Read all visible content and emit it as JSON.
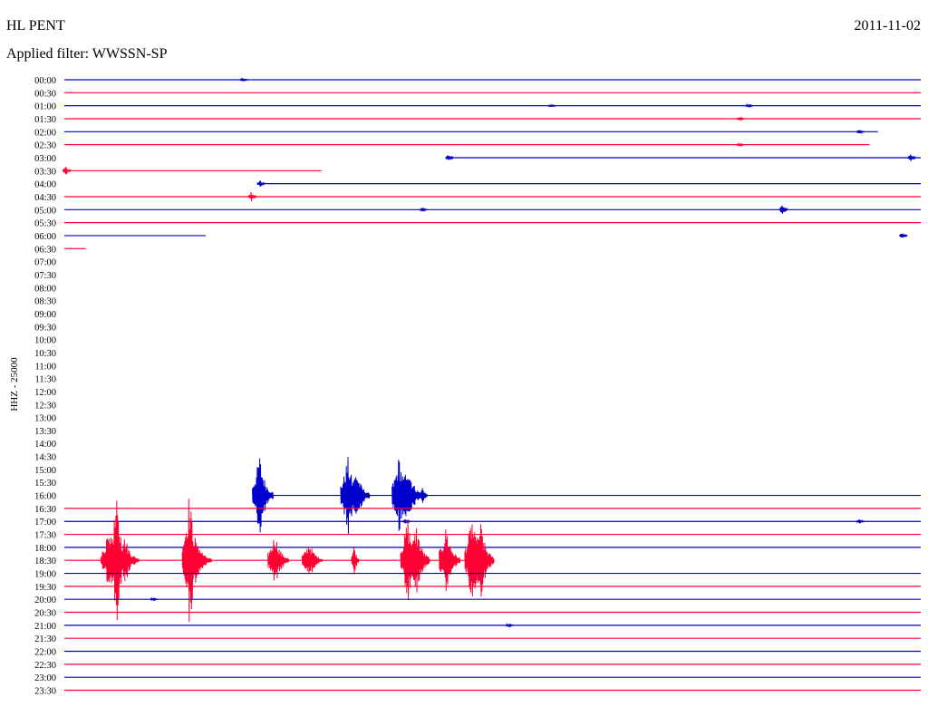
{
  "header": {
    "station": "HL PENT",
    "date": "2011-11-02",
    "filter": "Applied filter: WWSSN-SP"
  },
  "chart_data": {
    "type": "line",
    "title": "HL PENT",
    "ylabel": "HHZ - 25000",
    "series_colors": [
      "#0000cc",
      "#ff0033"
    ],
    "rows": [
      {
        "label": "00:00",
        "color": "#0000cc",
        "start": 0.0,
        "end": 1.0,
        "events": [
          {
            "at": 0.21,
            "amp": 2
          }
        ]
      },
      {
        "label": "00:30",
        "color": "#ff0033",
        "start": 0.0,
        "end": 1.0,
        "events": []
      },
      {
        "label": "01:00",
        "color": "#0000cc",
        "start": 0.0,
        "end": 1.0,
        "events": [
          {
            "at": 0.57,
            "amp": 2
          },
          {
            "at": 0.8,
            "amp": 2
          }
        ]
      },
      {
        "label": "01:30",
        "color": "#ff0033",
        "start": 0.0,
        "end": 1.0,
        "events": [
          {
            "at": 0.79,
            "amp": 2
          }
        ]
      },
      {
        "label": "02:00",
        "color": "#0000cc",
        "start": 0.0,
        "end": 0.95,
        "events": [
          {
            "at": 0.93,
            "amp": 3
          }
        ]
      },
      {
        "label": "02:30",
        "color": "#ff0033",
        "start": 0.0,
        "end": 0.94,
        "events": [
          {
            "at": 0.79,
            "amp": 2
          }
        ]
      },
      {
        "label": "03:00",
        "color": "#0000cc",
        "start": 0.45,
        "end": 1.0,
        "events": [
          {
            "at": 0.45,
            "amp": 5
          },
          {
            "at": 0.99,
            "amp": 5
          }
        ]
      },
      {
        "label": "03:30",
        "color": "#ff0033",
        "start": 0.0,
        "end": 0.3,
        "events": [
          {
            "at": 0.003,
            "amp": 6
          }
        ]
      },
      {
        "label": "04:00",
        "color": "#0000cc",
        "start": 0.23,
        "end": 1.0,
        "events": [
          {
            "at": 0.23,
            "amp": 4
          }
        ]
      },
      {
        "label": "04:30",
        "color": "#ff0033",
        "start": 0.0,
        "end": 1.0,
        "events": [
          {
            "at": 0.22,
            "amp": 6
          }
        ]
      },
      {
        "label": "05:00",
        "color": "#0000cc",
        "start": 0.0,
        "end": 1.0,
        "events": [
          {
            "at": 0.84,
            "amp": 8
          },
          {
            "at": 0.42,
            "amp": 2
          }
        ]
      },
      {
        "label": "05:30",
        "color": "#ff0033",
        "start": 0.0,
        "end": 1.0,
        "events": []
      },
      {
        "label": "06:00",
        "color": "#0000cc",
        "start": 0.0,
        "end": 0.165,
        "events": [
          {
            "at": 0.98,
            "amp": 4
          }
        ]
      },
      {
        "label": "06:30",
        "color": "#ff0033",
        "start": 0.0,
        "end": 0.025,
        "events": []
      },
      {
        "label": "07:00",
        "color": "#0000cc",
        "start": 0,
        "end": 0,
        "events": []
      },
      {
        "label": "07:30",
        "color": "#ff0033",
        "start": 0,
        "end": 0,
        "events": []
      },
      {
        "label": "08:00",
        "color": "#0000cc",
        "start": 0,
        "end": 0,
        "events": []
      },
      {
        "label": "08:30",
        "color": "#ff0033",
        "start": 0,
        "end": 0,
        "events": []
      },
      {
        "label": "09:00",
        "color": "#0000cc",
        "start": 0,
        "end": 0,
        "events": []
      },
      {
        "label": "09:30",
        "color": "#ff0033",
        "start": 0,
        "end": 0,
        "events": []
      },
      {
        "label": "10:00",
        "color": "#0000cc",
        "start": 0,
        "end": 0,
        "events": []
      },
      {
        "label": "10:30",
        "color": "#ff0033",
        "start": 0,
        "end": 0,
        "events": []
      },
      {
        "label": "11:00",
        "color": "#0000cc",
        "start": 0,
        "end": 0,
        "events": []
      },
      {
        "label": "11:30",
        "color": "#ff0033",
        "start": 0,
        "end": 0,
        "events": []
      },
      {
        "label": "12:00",
        "color": "#0000cc",
        "start": 0,
        "end": 0,
        "events": []
      },
      {
        "label": "12:30",
        "color": "#ff0033",
        "start": 0,
        "end": 0,
        "events": []
      },
      {
        "label": "13:00",
        "color": "#0000cc",
        "start": 0,
        "end": 0,
        "events": []
      },
      {
        "label": "13:30",
        "color": "#ff0033",
        "start": 0,
        "end": 0,
        "events": []
      },
      {
        "label": "14:00",
        "color": "#0000cc",
        "start": 0,
        "end": 0,
        "events": []
      },
      {
        "label": "14:30",
        "color": "#ff0033",
        "start": 0,
        "end": 0,
        "events": []
      },
      {
        "label": "15:00",
        "color": "#0000cc",
        "start": 0,
        "end": 0,
        "events": []
      },
      {
        "label": "15:30",
        "color": "#ff0033",
        "start": 0,
        "end": 0,
        "events": []
      },
      {
        "label": "16:00",
        "color": "#0000cc",
        "start": 0.23,
        "end": 1.0,
        "events": [
          {
            "at": 0.232,
            "amp": 48
          },
          {
            "at": 0.335,
            "amp": 45
          },
          {
            "at": 0.345,
            "amp": 30
          },
          {
            "at": 0.39,
            "amp": 15
          },
          {
            "at": 0.395,
            "amp": 46
          },
          {
            "at": 0.405,
            "amp": 40
          },
          {
            "at": 0.42,
            "amp": 12
          }
        ]
      },
      {
        "label": "16:30",
        "color": "#ff0033",
        "start": 0.0,
        "end": 1.0,
        "events": []
      },
      {
        "label": "17:00",
        "color": "#0000cc",
        "start": 0.0,
        "end": 1.0,
        "events": [
          {
            "at": 0.4,
            "amp": 3
          },
          {
            "at": 0.93,
            "amp": 3
          }
        ]
      },
      {
        "label": "17:30",
        "color": "#ff0033",
        "start": 0.0,
        "end": 1.0,
        "events": []
      },
      {
        "label": "18:00",
        "color": "#0000cc",
        "start": 0.0,
        "end": 1.0,
        "events": []
      },
      {
        "label": "18:30",
        "color": "#ff0033",
        "start": 0.0,
        "end": 0.5,
        "events": [
          {
            "at": 0.055,
            "amp": 30
          },
          {
            "at": 0.065,
            "amp": 70
          },
          {
            "at": 0.075,
            "amp": 28
          },
          {
            "at": 0.15,
            "amp": 80
          },
          {
            "at": 0.16,
            "amp": 22
          },
          {
            "at": 0.25,
            "amp": 32
          },
          {
            "at": 0.29,
            "amp": 22
          },
          {
            "at": 0.34,
            "amp": 20
          },
          {
            "at": 0.405,
            "amp": 50
          },
          {
            "at": 0.415,
            "amp": 42
          },
          {
            "at": 0.45,
            "amp": 40
          },
          {
            "at": 0.48,
            "amp": 52
          },
          {
            "at": 0.49,
            "amp": 45
          }
        ]
      },
      {
        "label": "19:00",
        "color": "#0000cc",
        "start": 0.0,
        "end": 1.0,
        "events": []
      },
      {
        "label": "19:30",
        "color": "#ff0033",
        "start": 0.0,
        "end": 1.0,
        "events": []
      },
      {
        "label": "20:00",
        "color": "#0000cc",
        "start": 0.0,
        "end": 1.0,
        "events": [
          {
            "at": 0.105,
            "amp": 2
          }
        ]
      },
      {
        "label": "20:30",
        "color": "#ff0033",
        "start": 0.0,
        "end": 1.0,
        "events": []
      },
      {
        "label": "21:00",
        "color": "#0000cc",
        "start": 0.0,
        "end": 1.0,
        "events": [
          {
            "at": 0.52,
            "amp": 2
          }
        ]
      },
      {
        "label": "21:30",
        "color": "#ff0033",
        "start": 0.0,
        "end": 1.0,
        "events": []
      },
      {
        "label": "22:00",
        "color": "#0000cc",
        "start": 0.0,
        "end": 1.0,
        "events": []
      },
      {
        "label": "22:30",
        "color": "#ff0033",
        "start": 0.0,
        "end": 1.0,
        "events": []
      },
      {
        "label": "23:00",
        "color": "#0000cc",
        "start": 0.0,
        "end": 1.0,
        "events": []
      },
      {
        "label": "23:30",
        "color": "#ff0033",
        "start": 0.0,
        "end": 1.0,
        "events": []
      }
    ]
  }
}
